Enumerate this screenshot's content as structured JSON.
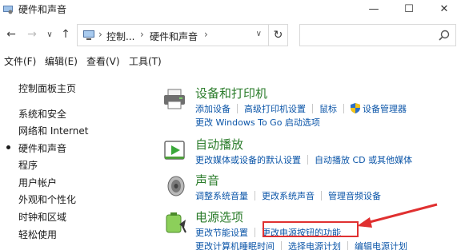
{
  "window": {
    "title": "硬件和声音",
    "minimize": "—",
    "maximize": "☐",
    "close": "✕"
  },
  "nav": {
    "back": "←",
    "forward": "→",
    "dropdown": "∨",
    "up": "↑",
    "breadcrumbs": [
      "控制...",
      "硬件和声音"
    ],
    "refresh": "↻",
    "search_placeholder": ""
  },
  "menu": [
    "文件(F)",
    "编辑(E)",
    "查看(V)",
    "工具(T)"
  ],
  "sidebar": {
    "items": [
      {
        "label": "控制面板主页"
      },
      {
        "label": "系统和安全"
      },
      {
        "label": "网络和 Internet"
      },
      {
        "label": "硬件和声音",
        "active": true
      },
      {
        "label": "程序"
      },
      {
        "label": "用户帐户"
      },
      {
        "label": "外观和个性化"
      },
      {
        "label": "时钟和区域"
      },
      {
        "label": "轻松使用"
      }
    ]
  },
  "sections": [
    {
      "title": "设备和打印机",
      "icon": "printer-icon",
      "rows": [
        [
          "添加设备",
          "高级打印机设置",
          "鼠标",
          "设备管理器"
        ],
        [
          "更改 Windows To Go 启动选项"
        ]
      ]
    },
    {
      "title": "自动播放",
      "icon": "autoplay-icon",
      "rows": [
        [
          "更改媒体或设备的默认设置",
          "自动播放 CD 或其他媒体"
        ]
      ]
    },
    {
      "title": "声音",
      "icon": "speaker-icon",
      "rows": [
        [
          "调整系统音量",
          "更改系统声音",
          "管理音频设备"
        ]
      ]
    },
    {
      "title": "电源选项",
      "icon": "power-icon",
      "rows": [
        [
          "更改节能设置",
          "更改电源按钮的功能"
        ],
        [
          "更改计算机睡眠时间",
          "选择电源计划",
          "编辑电源计划"
        ]
      ]
    }
  ],
  "colors": {
    "heading": "#2c7d2c",
    "link": "#0b55a8",
    "highlight": "#e03030"
  }
}
